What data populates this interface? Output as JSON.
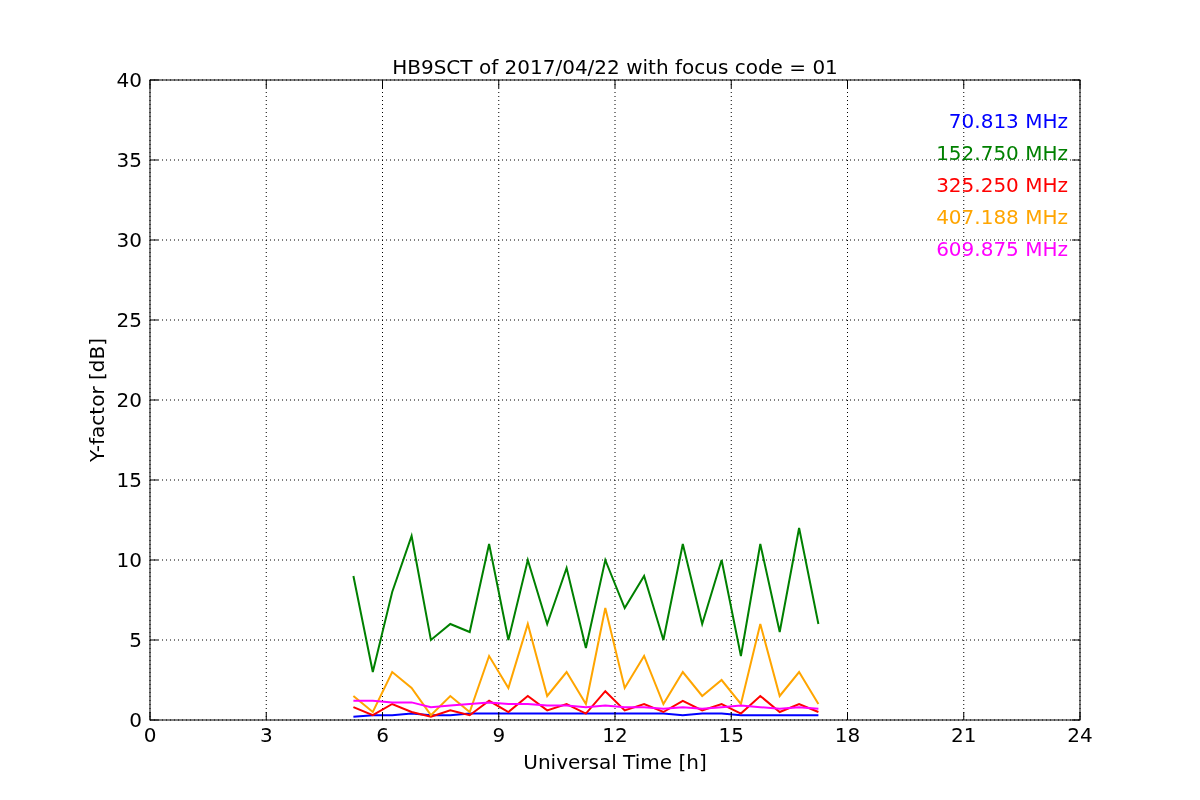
{
  "chart_data": {
    "type": "line",
    "title": "HB9SCT of 2017/04/22 with focus code = 01",
    "xlabel": "Universal Time [h]",
    "ylabel": "Y-factor [dB]",
    "x": [
      5.25,
      5.75,
      6.25,
      6.75,
      7.25,
      7.75,
      8.25,
      8.75,
      9.25,
      9.75,
      10.25,
      10.75,
      11.25,
      11.75,
      12.25,
      12.75,
      13.25,
      13.75,
      14.25,
      14.75,
      15.25,
      15.75,
      16.25,
      16.75,
      17.25
    ],
    "series": [
      {
        "name": "70.813 MHz",
        "color": "#0000ff",
        "values": [
          0.2,
          0.3,
          0.3,
          0.4,
          0.3,
          0.3,
          0.4,
          0.4,
          0.4,
          0.4,
          0.4,
          0.4,
          0.4,
          0.4,
          0.4,
          0.4,
          0.4,
          0.3,
          0.4,
          0.4,
          0.3,
          0.3,
          0.3,
          0.3,
          0.3
        ]
      },
      {
        "name": "152.750 MHz",
        "color": "#008000",
        "values": [
          9,
          3,
          8,
          11.5,
          5,
          6,
          5.5,
          11,
          5,
          10,
          6,
          9.5,
          4.5,
          10,
          7,
          9,
          5,
          11,
          6,
          10,
          4,
          11,
          5.5,
          12,
          6
        ]
      },
      {
        "name": "325.250 MHz",
        "color": "#ff0000",
        "values": [
          0.8,
          0.3,
          1,
          0.5,
          0.2,
          0.6,
          0.3,
          1.2,
          0.5,
          1.5,
          0.6,
          1,
          0.4,
          1.8,
          0.6,
          1,
          0.5,
          1.2,
          0.6,
          1,
          0.4,
          1.5,
          0.5,
          1,
          0.5
        ]
      },
      {
        "name": "407.188 MHz",
        "color": "#ffa500",
        "values": [
          1.5,
          0.5,
          3,
          2,
          0.3,
          1.5,
          0.5,
          4,
          2,
          6,
          1.5,
          3,
          1,
          7,
          2,
          4,
          1,
          3,
          1.5,
          2.5,
          1,
          6,
          1.5,
          3,
          1
        ]
      },
      {
        "name": "609.875 MHz",
        "color": "#ff00ff",
        "values": [
          1.2,
          1.2,
          1.1,
          1.1,
          0.8,
          0.9,
          1.0,
          1.1,
          1.0,
          1.0,
          0.9,
          0.9,
          0.8,
          0.9,
          0.8,
          0.8,
          0.7,
          0.8,
          0.7,
          0.8,
          0.9,
          0.8,
          0.7,
          0.8,
          0.7
        ]
      }
    ],
    "grid": true,
    "xlim": [
      0,
      24
    ],
    "ylim": [
      0,
      40
    ],
    "xticks": [
      0,
      3,
      6,
      9,
      12,
      15,
      18,
      21,
      24
    ],
    "yticks": [
      0,
      5,
      10,
      15,
      20,
      25,
      30,
      35,
      40
    ]
  }
}
